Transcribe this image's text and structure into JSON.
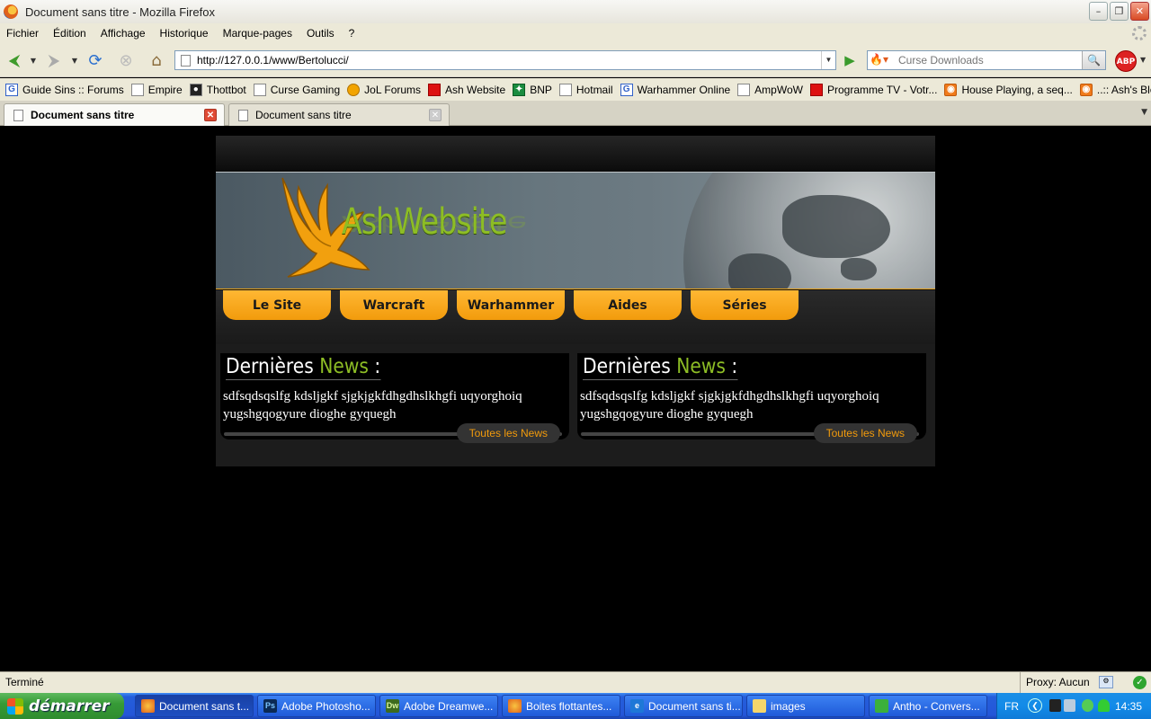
{
  "window": {
    "title": "Document sans titre - Mozilla Firefox",
    "controls": [
      "minimize",
      "maximize",
      "close"
    ]
  },
  "menubar": [
    "Fichier",
    "Édition",
    "Affichage",
    "Historique",
    "Marque-pages",
    "Outils",
    "?"
  ],
  "toolbar": {
    "url": "http://127.0.0.1/www/Bertolucci/",
    "search_placeholder": "Curse Downloads",
    "adblock_label": "ABP"
  },
  "bookmarks": [
    {
      "label": "Guide Sins :: Forums",
      "icon": "G"
    },
    {
      "label": "Empire",
      "icon": "page"
    },
    {
      "label": "Thottbot",
      "icon": "dark"
    },
    {
      "label": "Curse Gaming",
      "icon": "page"
    },
    {
      "label": "JoL Forums",
      "icon": "orange"
    },
    {
      "label": "Ash Website",
      "icon": "red"
    },
    {
      "label": "BNP",
      "icon": "green"
    },
    {
      "label": "Hotmail",
      "icon": "page"
    },
    {
      "label": "Warhammer Online",
      "icon": "G"
    },
    {
      "label": "AmpWoW",
      "icon": "page"
    },
    {
      "label": "Programme TV - Votr...",
      "icon": "red"
    },
    {
      "label": "House Playing, a seq...",
      "icon": "rss"
    },
    {
      "label": "..:: Ash's Blog - RSS ::...",
      "icon": "rss"
    }
  ],
  "tabs": [
    {
      "label": "Document sans titre",
      "active": true
    },
    {
      "label": "Document sans titre",
      "active": false
    }
  ],
  "site": {
    "logo_text": "AshWebsite",
    "nav": [
      "Le Site",
      "Warcraft",
      "Warhammer",
      "Aides",
      "Séries"
    ],
    "news": [
      {
        "title_main": "Dernières",
        "title_accent": "News",
        "title_suffix": " :",
        "body": "sdfsqdsqslfg kdsljgkf sjgkjgkfdhgdhslkhgfi uqyorghoiq yugshgqogyure dioghe gyquegh",
        "link": "Toutes les News"
      },
      {
        "title_main": "Dernières",
        "title_accent": "News",
        "title_suffix": " :",
        "body": "sdfsqdsqslfg kdsljgkf sjgkjgkfdhgdhslkhgfi uqyorghoiq yugshgqogyure dioghe gyquegh",
        "link": "Toutes les News"
      }
    ],
    "colors": {
      "accent_green": "#8dbd25",
      "nav_orange": "#f29b0c"
    }
  },
  "statusbar": {
    "status": "Terminé",
    "proxy": "Proxy: Aucun"
  },
  "taskbar": {
    "start_label": "démarrer",
    "tasks": [
      {
        "label": "Document sans t...",
        "icon": "firefox",
        "active": true
      },
      {
        "label": "Adobe Photosho...",
        "icon": "Ps",
        "active": false
      },
      {
        "label": "Adobe Dreamwe...",
        "icon": "Dw",
        "active": false
      },
      {
        "label": "Boites flottantes...",
        "icon": "firefox",
        "active": false
      },
      {
        "label": "Document sans ti...",
        "icon": "ie",
        "active": false
      },
      {
        "label": "images",
        "icon": "folder",
        "active": false
      },
      {
        "label": "Antho - Convers...",
        "icon": "msn",
        "active": false
      }
    ],
    "language": "FR",
    "clock": "14:35"
  }
}
